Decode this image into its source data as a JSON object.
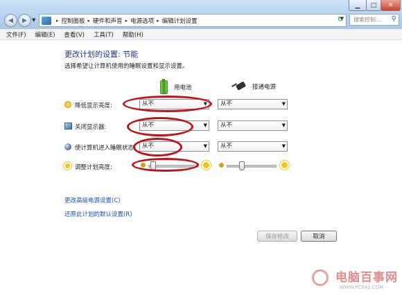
{
  "window": {
    "minimize_glyph": "▁",
    "maximize_glyph": "□",
    "close_glyph": "✕"
  },
  "address_bar": {
    "breadcrumbs": [
      "控制面板",
      "硬件和声音",
      "电源选项",
      "编辑计划设置"
    ]
  },
  "search": {
    "placeholder": "搜索控制..."
  },
  "menu": [
    "文件(F)",
    "编辑(E)",
    "查看(V)",
    "工具(T)",
    "帮助(H)"
  ],
  "page": {
    "title": "更改计划的设置: 节能",
    "subtitle": "选择希望让计算机使用的睡眠设置和显示设置。",
    "col_battery": "用电池",
    "col_ac": "接通电源"
  },
  "settings": [
    {
      "label": "降低显示亮度:",
      "battery": "从不",
      "ac": "从不"
    },
    {
      "label": "关闭显示器:",
      "battery": "从不",
      "ac": "从不"
    },
    {
      "label": "使计算机进入睡眠状态:",
      "battery": "从不",
      "ac": "从不"
    }
  ],
  "brightness": {
    "label": "调整计划亮度:",
    "battery_level": 0.08,
    "ac_level": 0.3
  },
  "links": {
    "advanced": "更改高级电源设置(C)",
    "restore": "还原此计划的默认设置(R)"
  },
  "buttons": {
    "save": "保存修改",
    "cancel": "取消"
  },
  "watermark": {
    "brand": "电脑百事网",
    "url": "WWW.PC841.COM"
  },
  "annotation_color": "#c0101a"
}
